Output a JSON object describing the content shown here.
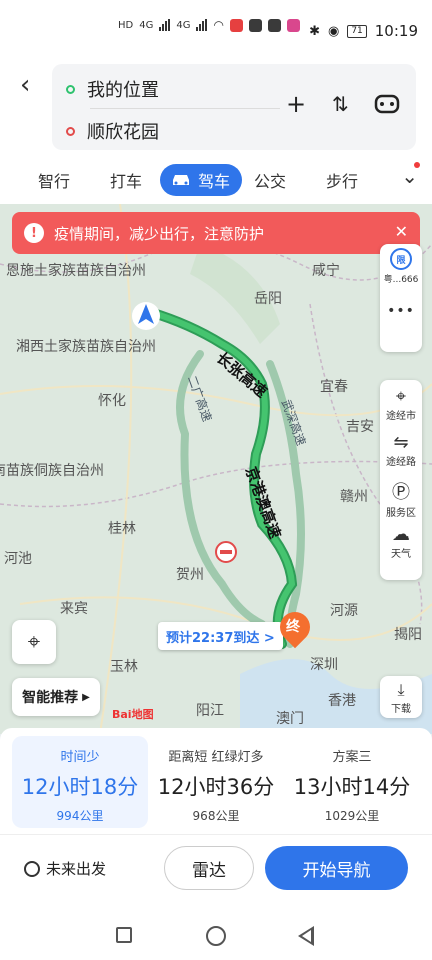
{
  "status_bar": {
    "time": "10:19",
    "battery": "71",
    "net_left": "4G",
    "net_right": "4G"
  },
  "header": {
    "back_icon": "back-arrow-icon",
    "start": "我的位置",
    "end": "顺欣花园"
  },
  "tabs": [
    {
      "label": "智行"
    },
    {
      "label": "打车"
    },
    {
      "label": "驾车",
      "active": true
    },
    {
      "label": "公交"
    },
    {
      "label": "步行"
    }
  ],
  "alert": {
    "text": "疫情期间，减少出行，注意防护"
  },
  "map": {
    "places": [
      "恩施土家族苗族自治州",
      "岳阳",
      "咸宁",
      "湘西土家族苗族自治州",
      "宜春",
      "怀化",
      "吉安",
      "黔东南苗族侗族自治州",
      "赣州",
      "桂林",
      "河池",
      "贺州",
      "来宾",
      "河源",
      "揭阳",
      "玉林",
      "深圳",
      "阳江",
      "香港",
      "澳门"
    ],
    "roads": [
      "长张高速",
      "京港澳高速",
      "武深高速",
      "二广高速"
    ],
    "eta_label": "预计22:37到达 >",
    "end_pin": "终",
    "map_brand": "Bai地图"
  },
  "side_panel": {
    "plate": "粤...666",
    "restrict_label": "限",
    "more": "•••",
    "items": [
      {
        "label": "途经市",
        "icon": "city-pin-icon"
      },
      {
        "label": "途经路",
        "icon": "road-icon"
      },
      {
        "label": "服务区",
        "icon": "service-area-icon"
      },
      {
        "label": "天气",
        "icon": "weather-icon"
      }
    ],
    "download": "下载"
  },
  "map_controls": {
    "recommend": "智能推荐"
  },
  "plans": [
    {
      "tag": "时间少",
      "time": "12小时18分",
      "dist": "994公里",
      "selected": true
    },
    {
      "tag": "距离短  红绿灯多",
      "time": "12小时36分",
      "dist": "968公里"
    },
    {
      "tag": "方案三",
      "time": "13小时14分",
      "dist": "1029公里"
    }
  ],
  "actions": {
    "future": "未来出发",
    "radar": "雷达",
    "navigate": "开始导航"
  },
  "colors": {
    "accent": "#2f75ea",
    "alert": "#f25a5a",
    "route_main": "#3cb371",
    "route_alt": "#9fc9ad"
  }
}
